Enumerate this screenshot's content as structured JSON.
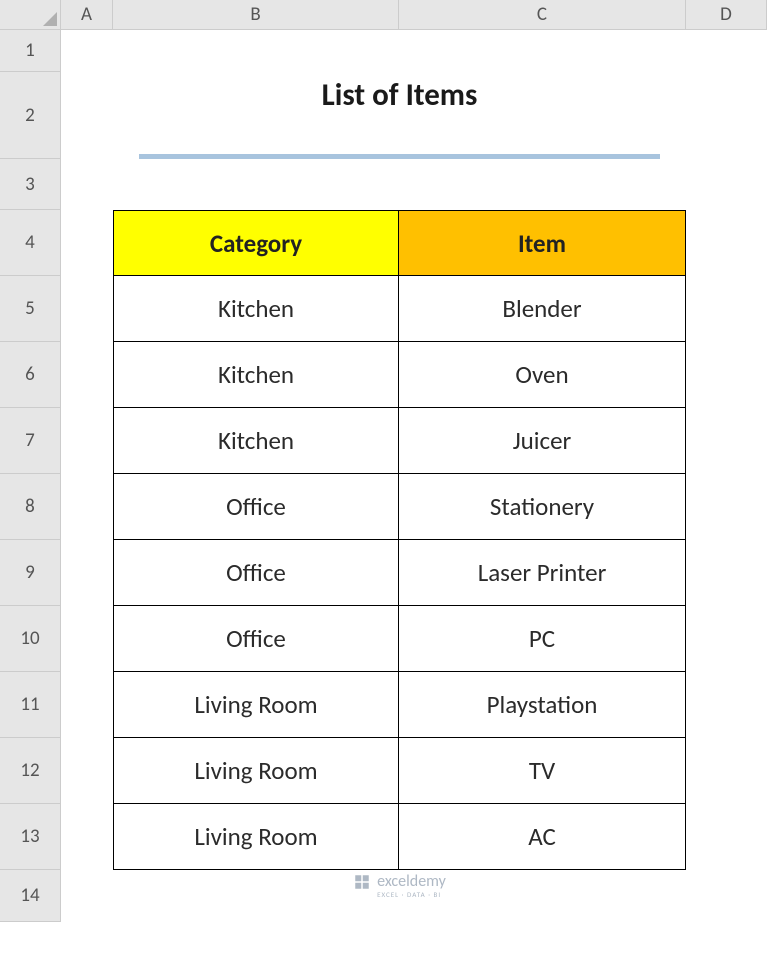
{
  "columns": [
    "A",
    "B",
    "C",
    "D"
  ],
  "rows": [
    "1",
    "2",
    "3",
    "4",
    "5",
    "6",
    "7",
    "8",
    "9",
    "10",
    "11",
    "12",
    "13",
    "14"
  ],
  "title": "List of Items",
  "headers": {
    "category": "Category",
    "item": "Item"
  },
  "data": [
    {
      "category": "Kitchen",
      "item": "Blender"
    },
    {
      "category": "Kitchen",
      "item": "Oven"
    },
    {
      "category": "Kitchen",
      "item": "Juicer"
    },
    {
      "category": "Office",
      "item": "Stationery"
    },
    {
      "category": "Office",
      "item": "Laser Printer"
    },
    {
      "category": "Office",
      "item": "PC"
    },
    {
      "category": "Living Room",
      "item": "Playstation"
    },
    {
      "category": "Living Room",
      "item": "TV"
    },
    {
      "category": "Living Room",
      "item": "AC"
    }
  ],
  "watermark": {
    "brand": "exceldemy",
    "tagline": "EXCEL · DATA · BI"
  },
  "colors": {
    "header_cat": "#ffff00",
    "header_item": "#ffc000",
    "title_underline": "#a8c4de"
  },
  "chart_data": {
    "type": "table",
    "title": "List of Items",
    "columns": [
      "Category",
      "Item"
    ],
    "rows": [
      [
        "Kitchen",
        "Blender"
      ],
      [
        "Kitchen",
        "Oven"
      ],
      [
        "Kitchen",
        "Juicer"
      ],
      [
        "Office",
        "Stationery"
      ],
      [
        "Office",
        "Laser Printer"
      ],
      [
        "Office",
        "PC"
      ],
      [
        "Living Room",
        "Playstation"
      ],
      [
        "Living Room",
        "TV"
      ],
      [
        "Living Room",
        "AC"
      ]
    ]
  }
}
